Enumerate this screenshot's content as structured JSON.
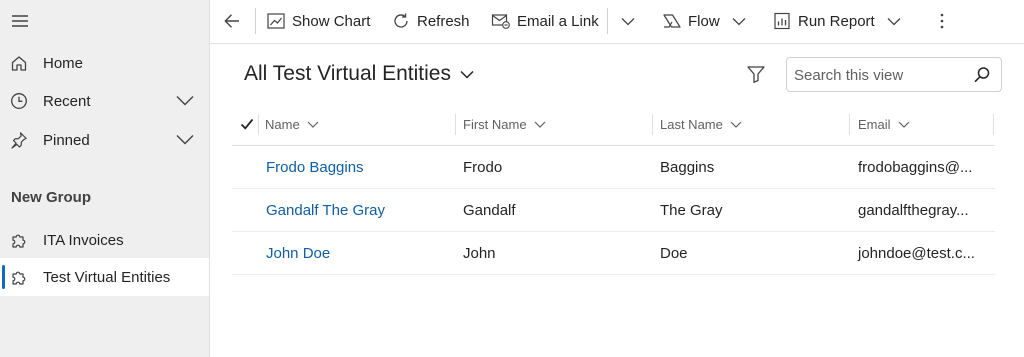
{
  "sidebar": {
    "items": [
      {
        "label": "Home"
      },
      {
        "label": "Recent"
      },
      {
        "label": "Pinned"
      }
    ],
    "group_title": "New Group",
    "group_items": [
      {
        "label": "ITA Invoices"
      },
      {
        "label": "Test Virtual Entities"
      }
    ]
  },
  "commandbar": {
    "show_chart": "Show Chart",
    "refresh": "Refresh",
    "email_link": "Email a Link",
    "flow": "Flow",
    "run_report": "Run Report"
  },
  "view": {
    "title": "All Test Virtual Entities",
    "search_placeholder": "Search this view"
  },
  "grid": {
    "columns": [
      "Name",
      "First Name",
      "Last Name",
      "Email"
    ],
    "rows": [
      {
        "name": "Frodo Baggins",
        "first": "Frodo",
        "last": "Baggins",
        "email": "frodobaggins@..."
      },
      {
        "name": "Gandalf The Gray",
        "first": "Gandalf",
        "last": "The Gray",
        "email": "gandalfthegray..."
      },
      {
        "name": "John Doe",
        "first": "John",
        "last": "Doe",
        "email": "johndoe@test.c..."
      }
    ]
  },
  "colors": {
    "accent": "#0f6cbd",
    "link": "#115ea3",
    "sidebar_bg": "#efefef"
  }
}
